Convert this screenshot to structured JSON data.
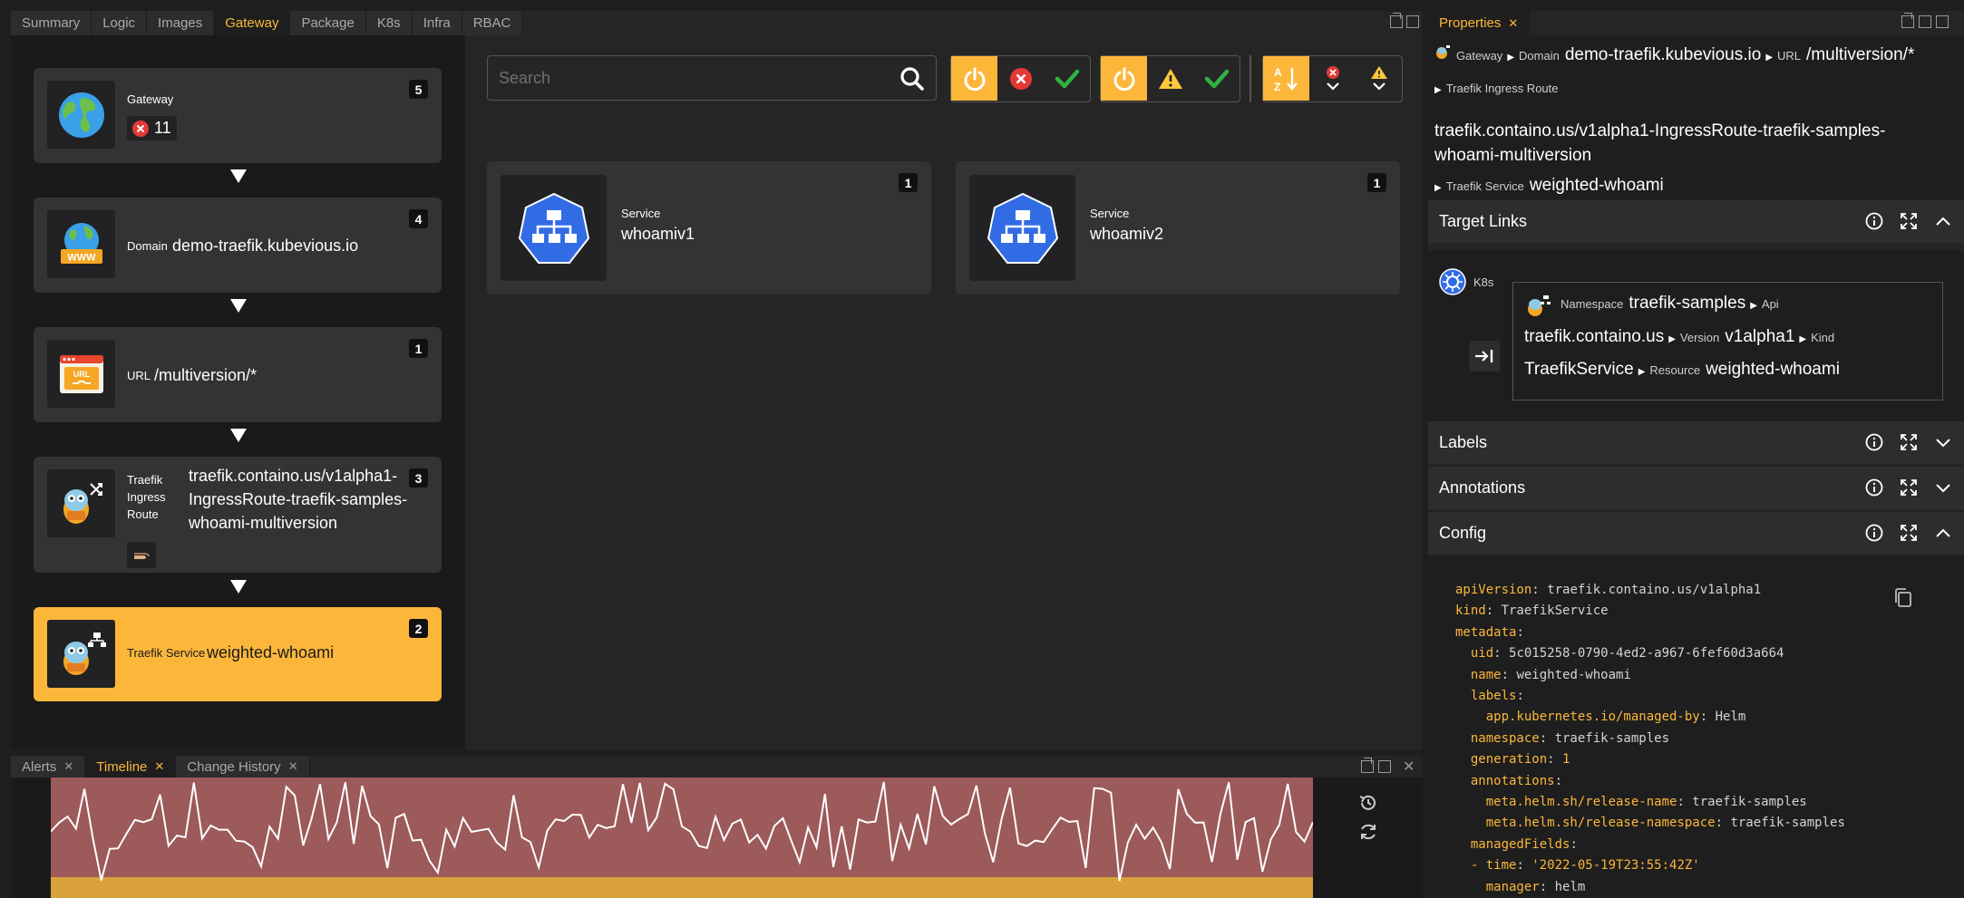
{
  "main_tabs": [
    {
      "label": "Summary",
      "active": false
    },
    {
      "label": "Logic",
      "active": false
    },
    {
      "label": "Images",
      "active": false
    },
    {
      "label": "Gateway",
      "active": true
    },
    {
      "label": "Package",
      "active": false
    },
    {
      "label": "K8s",
      "active": false
    },
    {
      "label": "Infra",
      "active": false
    },
    {
      "label": "RBAC",
      "active": false
    }
  ],
  "gateway_nodes": [
    {
      "kind": "Gateway",
      "name": "",
      "count": "5",
      "error_count": "11",
      "icon": "globe-icon"
    },
    {
      "kind": "Domain",
      "name": "demo-traefik.kubevious.io",
      "count": "4",
      "icon": "www-globe-icon"
    },
    {
      "kind": "URL",
      "name": "/multiversion/*",
      "count": "1",
      "icon": "url-icon"
    },
    {
      "kind": "Traefik Ingress Route",
      "kind_lines": [
        "Traefik",
        "Ingress",
        "Route"
      ],
      "name_lines": [
        "traefik.containo.us/v1alpha1-",
        "IngressRoute-traefik-samples-",
        "whoami-multiversion"
      ],
      "count": "3",
      "icon": "traefik-route-icon"
    },
    {
      "kind": "Traefik Service",
      "name": "weighted-whoami",
      "count": "2",
      "icon": "traefik-service-icon",
      "selected": true
    }
  ],
  "search": {
    "placeholder": "Search",
    "value": ""
  },
  "services": [
    {
      "kind": "Service",
      "name": "whoamiv1",
      "count": "1"
    },
    {
      "kind": "Service",
      "name": "whoamiv2",
      "count": "1"
    }
  ],
  "bottom_tabs": [
    {
      "label": "Alerts",
      "active": false
    },
    {
      "label": "Timeline",
      "active": true
    },
    {
      "label": "Change History",
      "active": false
    }
  ],
  "properties": {
    "tab_label": "Properties",
    "breadcrumb": {
      "gateway_label": "Gateway",
      "domain_label": "Domain",
      "domain_value": "demo-traefik.kubevious.io",
      "url_label": "URL",
      "url_value": "/multiversion/*",
      "ingress_label": "Traefik Ingress Route",
      "dn_title": "traefik.containo.us/v1alpha1-IngressRoute-traefik-samples-whoami-multiversion",
      "service_label": "Traefik Service",
      "service_value": "weighted-whoami"
    },
    "sections": {
      "target_links": "Target Links",
      "labels": "Labels",
      "annotations": "Annotations",
      "config": "Config"
    },
    "target_link": {
      "source": "K8s",
      "namespace_label": "Namespace",
      "namespace_value": "traefik-samples",
      "api_label": "Api",
      "api_value": "traefik.containo.us",
      "version_label": "Version",
      "version_value": "v1alpha1",
      "kind_label": "Kind",
      "kind_value": "TraefikService",
      "resource_label": "Resource",
      "resource_value": "weighted-whoami"
    },
    "config_yaml": [
      {
        "indent": 0,
        "key": "apiVersion",
        "value": "traefik.containo.us/v1alpha1"
      },
      {
        "indent": 0,
        "key": "kind",
        "value": "TraefikService"
      },
      {
        "indent": 0,
        "key": "metadata",
        "value": ""
      },
      {
        "indent": 1,
        "key": "uid",
        "value": "5c015258-0790-4ed2-a967-6fef60d3a664"
      },
      {
        "indent": 1,
        "key": "name",
        "value": "weighted-whoami"
      },
      {
        "indent": 1,
        "key": "labels",
        "value": ""
      },
      {
        "indent": 2,
        "key": "app.kubernetes.io/managed-by",
        "value": "Helm"
      },
      {
        "indent": 1,
        "key": "namespace",
        "value": "traefik-samples"
      },
      {
        "indent": 1,
        "key": "generation",
        "value": "1",
        "numeric": true
      },
      {
        "indent": 1,
        "key": "annotations",
        "value": ""
      },
      {
        "indent": 2,
        "key": "meta.helm.sh/release-name",
        "value": "traefik-samples"
      },
      {
        "indent": 2,
        "key": "meta.helm.sh/release-namespace",
        "value": "traefik-samples"
      },
      {
        "indent": 1,
        "key": "managedFields",
        "value": ""
      },
      {
        "indent": 1,
        "key": "- time",
        "value": "'2022-05-19T23:55:42Z'",
        "string": true
      },
      {
        "indent": 2,
        "key": "manager",
        "value": "helm"
      }
    ]
  },
  "colors": {
    "accent": "#fcb73b",
    "error": "#e53935",
    "ok": "#2fb344",
    "timeline_red": "#9c5a5a",
    "timeline_yellow": "#d9a23a",
    "service_blue": "#326ce5"
  }
}
